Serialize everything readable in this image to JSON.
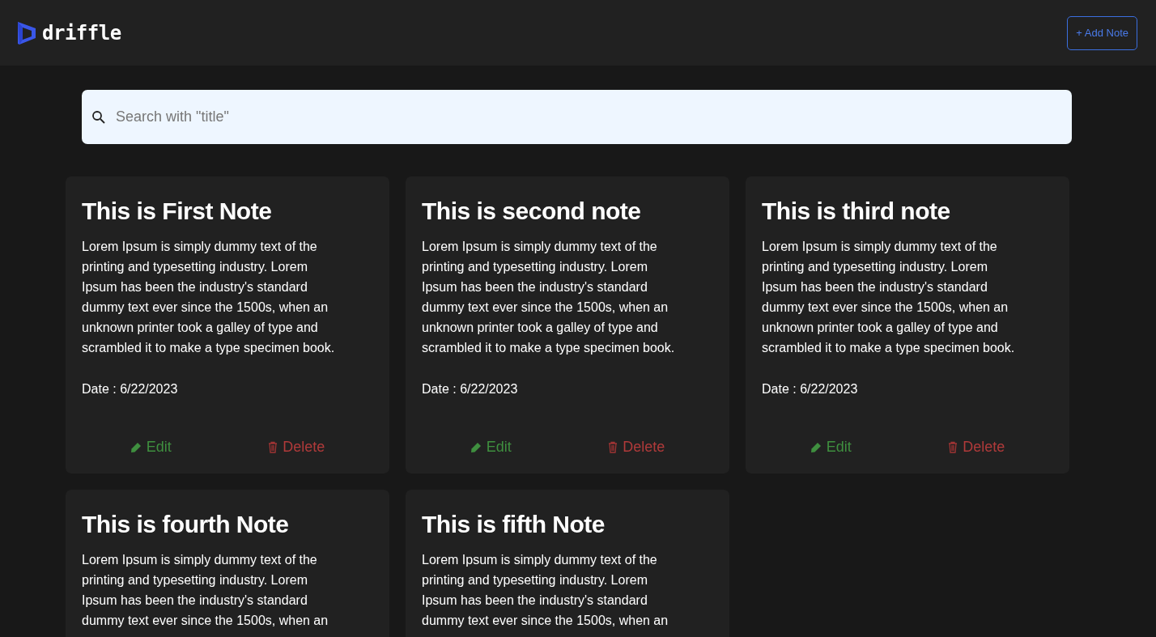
{
  "header": {
    "logo_text": "driffle",
    "add_button": "+ Add Note"
  },
  "search": {
    "placeholder": "Search with \"title\""
  },
  "notes": [
    {
      "title": "This is First Note",
      "body_lines": [
        "Lorem Ipsum is simply dummy text of the",
        "printing and typesetting industry. Lorem",
        "Ipsum has been the industry's standard",
        "dummy text ever since the 1500s, when an",
        "unknown printer took a galley of type and",
        "scrambled it to make a type specimen book."
      ],
      "date": "Date : 6/22/2023",
      "edit": "Edit",
      "delete": "Delete"
    },
    {
      "title": "This is second note",
      "body_lines": [
        "Lorem Ipsum is simply dummy text of the",
        "printing and typesetting industry. Lorem",
        "Ipsum has been the industry's standard",
        "dummy text ever since the 1500s, when an",
        "unknown printer took a galley of type and",
        "scrambled it to make a type specimen book."
      ],
      "date": "Date : 6/22/2023",
      "edit": "Edit",
      "delete": "Delete"
    },
    {
      "title": "This is third note",
      "body_lines": [
        "Lorem Ipsum is simply dummy text of the",
        "printing and typesetting industry. Lorem",
        "Ipsum has been the industry's standard",
        "dummy text ever since the 1500s, when an",
        "unknown printer took a galley of type and",
        "scrambled it to make a type specimen book."
      ],
      "date": "Date : 6/22/2023",
      "edit": "Edit",
      "delete": "Delete"
    },
    {
      "title": "This is fourth Note",
      "body_lines": [
        "Lorem Ipsum is simply dummy text of the",
        "printing and typesetting industry. Lorem",
        "Ipsum has been the industry's standard",
        "dummy text ever since the 1500s, when an"
      ]
    },
    {
      "title": "This is fifth Note",
      "body_lines": [
        "Lorem Ipsum is simply dummy text of the",
        "printing and typesetting industry. Lorem",
        "Ipsum has been the industry's standard",
        "dummy text ever since the 1500s, when an"
      ]
    }
  ]
}
